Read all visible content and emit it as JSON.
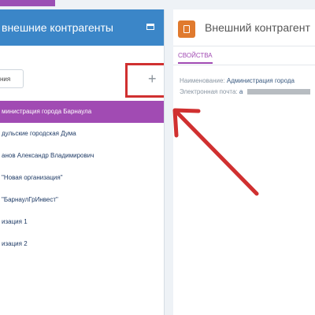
{
  "left_panel": {
    "title": "внешние контрагенты",
    "search_placeholder": "ния",
    "add_label": "+",
    "items": [
      {
        "label": "министрация города Барнаула",
        "selected": true
      },
      {
        "label": "дульские городская Дума"
      },
      {
        "label": "анов Александр Владимирович"
      },
      {
        "label": "\"Новая организация\""
      },
      {
        "label": "\"БарнаулГрИнвест\""
      },
      {
        "label": "изация 1"
      },
      {
        "label": "изация 2"
      }
    ]
  },
  "right_panel": {
    "title": "Внешний контрагент",
    "tab_label": "СВОЙСТВА",
    "name_label": "Наименование:",
    "name_value": "Администрация города",
    "email_label": "Электронная почта:",
    "email_value": "а"
  },
  "colors": {
    "header_blue": "#3b86c8",
    "selected_purple": "#a14bb3",
    "annotation_red": "#d03030",
    "doc_icon_orange": "#e07a2e"
  },
  "icons": [
    "maximize-icon",
    "plus-icon",
    "document-icon",
    "red-arrow-annotation"
  ]
}
